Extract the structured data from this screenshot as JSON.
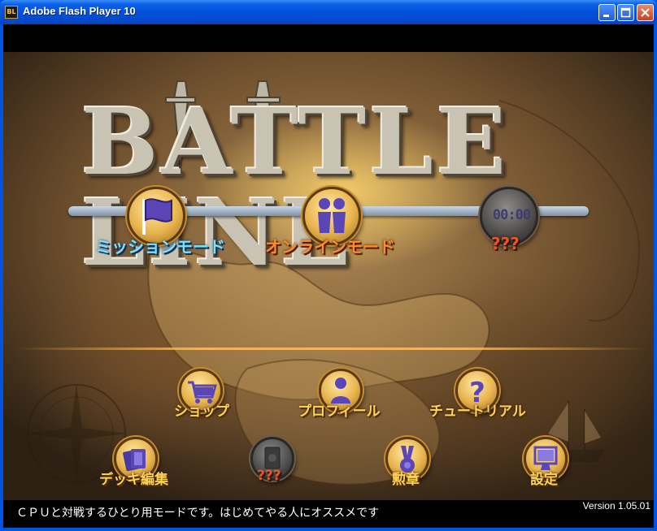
{
  "window": {
    "title": "Adobe Flash Player 10",
    "icon_label": "BL"
  },
  "game": {
    "logo": "BATTLE LINE",
    "modes": [
      {
        "label": "ミッションモード",
        "icon": "flag-icon"
      },
      {
        "label": "オンラインモード",
        "icon": "players-icon"
      },
      {
        "label": "???",
        "clock": "00:00",
        "icon": "clock-icon"
      }
    ],
    "menu_row1": [
      {
        "label": "ショップ",
        "icon": "cart-icon"
      },
      {
        "label": "プロフィール",
        "icon": "person-icon"
      },
      {
        "label": "チュートリアル",
        "icon": "question-icon"
      }
    ],
    "menu_row2": [
      {
        "label": "デッキ編集",
        "icon": "cards-icon"
      },
      {
        "label": "???",
        "icon": "locked-card-icon"
      },
      {
        "label": "勲章",
        "icon": "medal-icon"
      },
      {
        "label": "設定",
        "icon": "monitor-icon"
      }
    ],
    "status_text": "ＣＰＵと対戦するひとり用モードです。はじめてやる人にオススメです",
    "version": "Version 1.05.01"
  },
  "colors": {
    "titlebar": "#0352d9",
    "accent_gold": "#e8b34c",
    "mode_blue": "#7fe0f5",
    "mode_orange": "#ff8a2a"
  }
}
